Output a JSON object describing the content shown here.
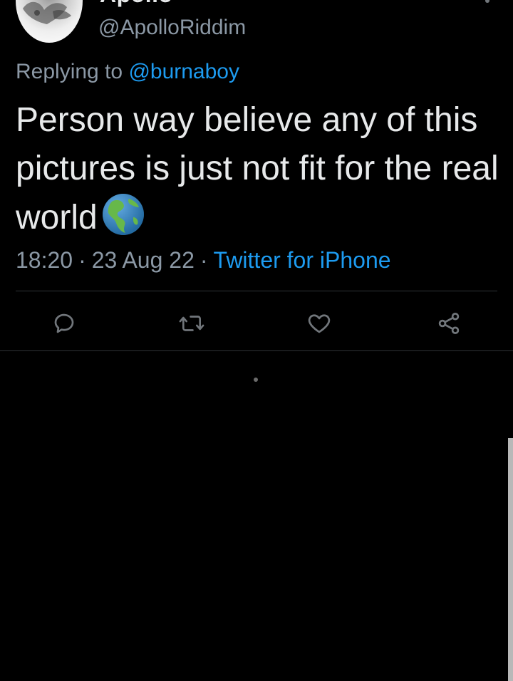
{
  "author": {
    "display_name": "Apollo",
    "handle": "@ApolloRiddim"
  },
  "reply": {
    "prefix": "Replying to",
    "mention": "@burnaboy"
  },
  "tweet": {
    "text": "Person way believe any of this pictures is just not fit for the real world",
    "emoji": "globe-showing-americas"
  },
  "meta": {
    "time": "18:20",
    "date": "23 Aug 22",
    "separator": "·",
    "source": "Twitter for iPhone"
  },
  "actions": [
    {
      "name": "reply",
      "icon": "reply-icon"
    },
    {
      "name": "retweet",
      "icon": "retweet-icon"
    },
    {
      "name": "like",
      "icon": "heart-icon"
    },
    {
      "name": "share",
      "icon": "share-icon"
    }
  ],
  "colors": {
    "background": "#000000",
    "text": "#e7e9ea",
    "secondary": "#8b98a5",
    "accent": "#1d9bf0",
    "divider": "#2f3336"
  }
}
